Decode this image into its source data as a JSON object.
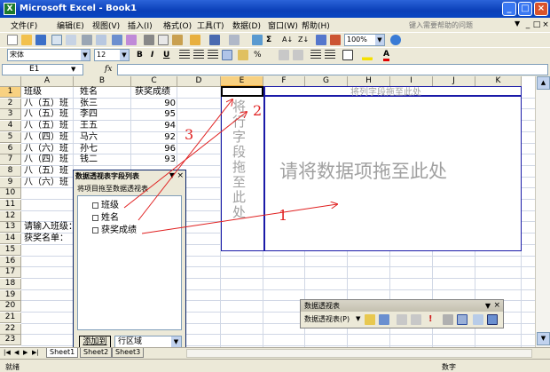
{
  "window": {
    "title": "Microsoft Excel - Book1",
    "icon": "excel-icon"
  },
  "menu": [
    "文件(F)",
    "编辑(E)",
    "视图(V)",
    "插入(I)",
    "格式(O)",
    "工具(T)",
    "数据(D)",
    "窗口(W)",
    "帮助(H)"
  ],
  "help_placeholder": "键入需要帮助的问题",
  "toolbar": {
    "zoom": "100%",
    "font": "宋体",
    "size": "12",
    "bold": "B",
    "italic": "I",
    "underline": "U",
    "percent": "%"
  },
  "formula": {
    "namebox": "E1",
    "fx": "fx"
  },
  "columns": [
    "A",
    "B",
    "C",
    "D",
    "E",
    "F",
    "G",
    "H",
    "I",
    "J",
    "K"
  ],
  "rows": [
    "1",
    "2",
    "3",
    "4",
    "5",
    "6",
    "7",
    "8",
    "9",
    "10",
    "11",
    "12",
    "13",
    "14",
    "15",
    "16",
    "17",
    "18",
    "19",
    "20",
    "21",
    "22",
    "23"
  ],
  "cells": {
    "a": [
      "班级",
      "八（五）班",
      "八（五）班",
      "八（五）班",
      "八（四）班",
      "八（六）班",
      "八（四）班",
      "八（五）班",
      "八（六）班"
    ],
    "b": [
      "姓名",
      "张三",
      "李四",
      "王五",
      "马六",
      "孙七",
      "钱二"
    ],
    "c": [
      "获奖成绩",
      "90",
      "95",
      "94",
      "92",
      "96",
      "93"
    ],
    "a13": "请输入班级：",
    "a14": "获奖名单："
  },
  "pivot": {
    "col_hint": "将列字段拖至此处",
    "row_hint": "将行字段拖至此处",
    "data_hint": "请将数据项拖至此处",
    "labels": [
      "1",
      "2",
      "3"
    ]
  },
  "fieldlist": {
    "title": "数据透视表字段列表",
    "hint": "将项目拖至数据透视表",
    "fields": [
      "班级",
      "姓名",
      "获奖成绩"
    ],
    "add_button": "添加到",
    "area": "行区域"
  },
  "pivot_toolbar": {
    "title": "数据透视表",
    "menu": "数据透视表(P)"
  },
  "sheets": {
    "active": "Sheet1",
    "others": [
      "Sheet2",
      "Sheet3"
    ]
  },
  "status": {
    "left": "就绪",
    "num": "数字"
  },
  "colors": {
    "pivot_border": "#1a1aa8",
    "arrow": "#e02020",
    "hint_gray": "#a0a0a0",
    "titlebar": "#0a3fb8"
  }
}
